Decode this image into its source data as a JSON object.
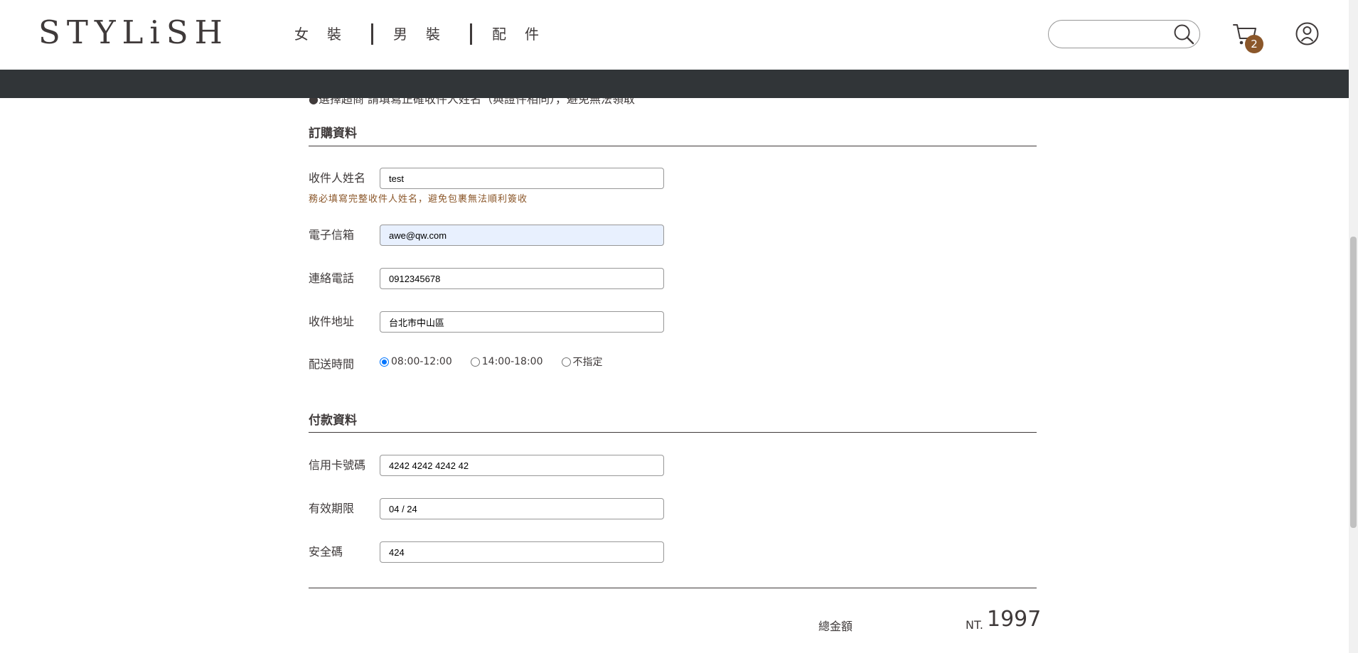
{
  "header": {
    "logo": "STYLiSH",
    "nav": [
      "女裝",
      "男裝",
      "配件"
    ],
    "search_placeholder": "",
    "cart_count": "2"
  },
  "partial_note": "●選擇超商 請填寫正確收件人姓名（與證件相同），避免無法領取",
  "order_section": {
    "title": "訂購資料",
    "name_label": "收件人姓名",
    "name_value": "test",
    "name_hint": "務必填寫完整收件人姓名，避免包裹無法順利簽收",
    "email_label": "電子信箱",
    "email_value": "awe@qw.com",
    "phone_label": "連絡電話",
    "phone_value": "0912345678",
    "address_label": "收件地址",
    "address_value": "台北市中山區",
    "time_label": "配送時間",
    "time_options": [
      "08:00-12:00",
      "14:00-18:00",
      "不指定"
    ],
    "time_selected": "08:00-12:00"
  },
  "payment_section": {
    "title": "付款資料",
    "card_label": "信用卡號碼",
    "card_value": "4242 4242 4242 42",
    "expiry_label": "有效期限",
    "expiry_value": "04 / 24",
    "cvv_label": "安全碼",
    "cvv_value": "424"
  },
  "summary": {
    "total_label": "總金額",
    "currency": "NT.",
    "total_value": "1997"
  },
  "colors": {
    "text": "#3f3a3a",
    "accent": "#8b572a",
    "dark_bar": "#313538",
    "radio": "#0075ff"
  }
}
